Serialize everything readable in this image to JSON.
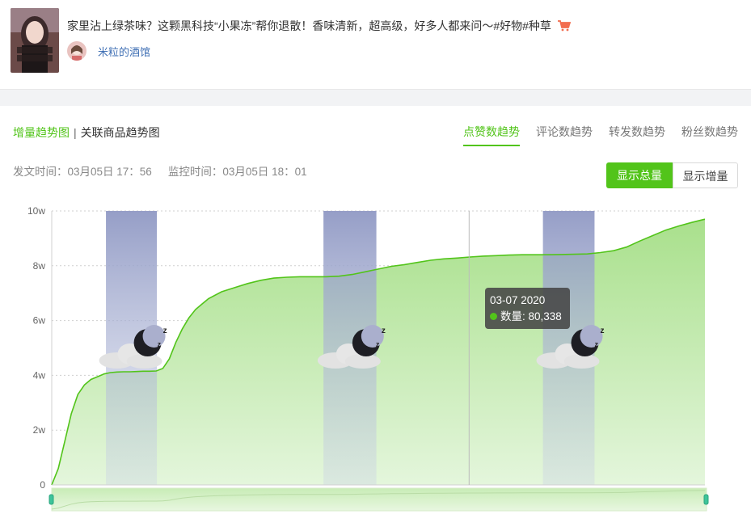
{
  "post": {
    "title": "家里沾上绿茶味？这颗黑科技“小果冻”帮你退散！香味清新，超高级，好多人都来问～#好物#种草",
    "author": "米粒的酒馆",
    "thumbnail_text": "",
    "cart_icon": "cart-icon"
  },
  "left_tabs": {
    "active": "增量趋势图",
    "other": "关联商品趋势图",
    "separator": "|"
  },
  "right_tabs": [
    "点赞数趋势",
    "评论数趋势",
    "转发数趋势",
    "粉丝数趋势"
  ],
  "right_tabs_active": 0,
  "times": {
    "post_time": "发文时间：03月05日 17：56",
    "monitor_time": "监控时间：03月05日 18：01"
  },
  "buttons": {
    "total": "显示总量",
    "increment": "显示增量"
  },
  "tooltip": {
    "date": "03-07 2020",
    "label": "数量: 80,338"
  },
  "colors": {
    "accent": "#52c41a",
    "area_top": "#a9e08c",
    "area_bottom": "#e4f6dc",
    "night_band": "#9099c4"
  },
  "chart_data": {
    "type": "area",
    "title": "",
    "xlabel": "",
    "ylabel": "",
    "y_tick_labels": [
      "0",
      "2w",
      "4w",
      "6w",
      "8w",
      "10w"
    ],
    "y_ticks": [
      0,
      20000,
      40000,
      60000,
      80000,
      100000
    ],
    "ylim": [
      0,
      100000
    ],
    "xlim": [
      0,
      100
    ],
    "grid": true,
    "series": [
      {
        "x": [
          0,
          1,
          2,
          3,
          4,
          5,
          6,
          7,
          8,
          9,
          10,
          11,
          12,
          13,
          14,
          15,
          16,
          17,
          18,
          19,
          20,
          21,
          22,
          23,
          24,
          26,
          28,
          30,
          32,
          34,
          36,
          38,
          40,
          42,
          44,
          46,
          48,
          50,
          52,
          54,
          56,
          58,
          60,
          62,
          64,
          66,
          68,
          70,
          72,
          74,
          76,
          78,
          80,
          82,
          84,
          86,
          88,
          90,
          92,
          94,
          96,
          98,
          100
        ],
        "values": [
          0,
          6000,
          16000,
          26000,
          33000,
          36500,
          38500,
          39500,
          40500,
          41000,
          41200,
          41300,
          41300,
          41400,
          41500,
          41500,
          41600,
          42500,
          46000,
          52000,
          57000,
          61000,
          64000,
          66000,
          68000,
          70500,
          72000,
          73500,
          74700,
          75500,
          75800,
          76000,
          76000,
          76000,
          76200,
          76800,
          77800,
          78800,
          79800,
          80400,
          81200,
          82000,
          82500,
          82800,
          83200,
          83500,
          83700,
          83900,
          84000,
          84000,
          84000,
          84100,
          84200,
          84300,
          84800,
          85500,
          86800,
          89000,
          91000,
          93000,
          94500,
          95800,
          97000
        ]
      }
    ],
    "night_bands": [
      [
        8.3,
        16.1
      ],
      [
        41.6,
        49.7
      ],
      [
        75.2,
        83.1
      ]
    ],
    "crosshair_x": 63.9,
    "tooltip_point": {
      "x": "03-07 2020",
      "y": 80338
    }
  }
}
